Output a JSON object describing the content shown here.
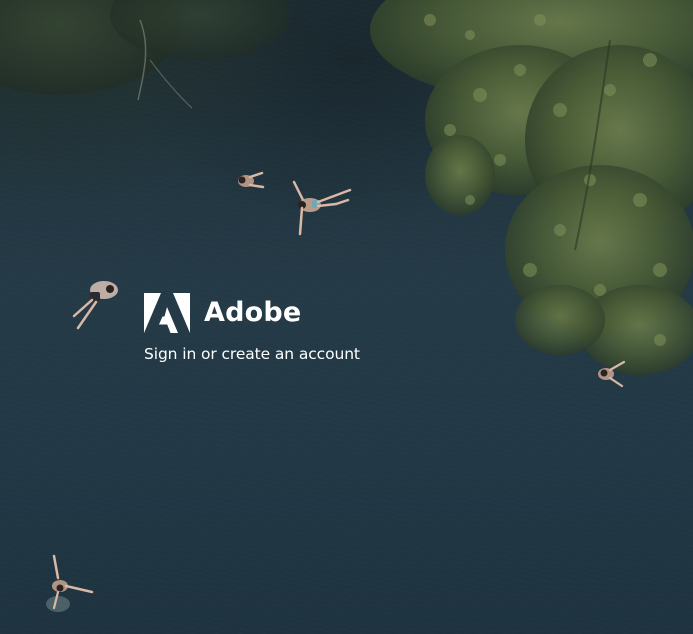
{
  "brand": {
    "name": "Adobe",
    "logo_icon": "adobe-logo-icon",
    "logo_color": "#ffffff"
  },
  "tagline": "Sign in or create an account",
  "background": {
    "water_color": "#223440",
    "foliage_color": "#4f6238"
  }
}
